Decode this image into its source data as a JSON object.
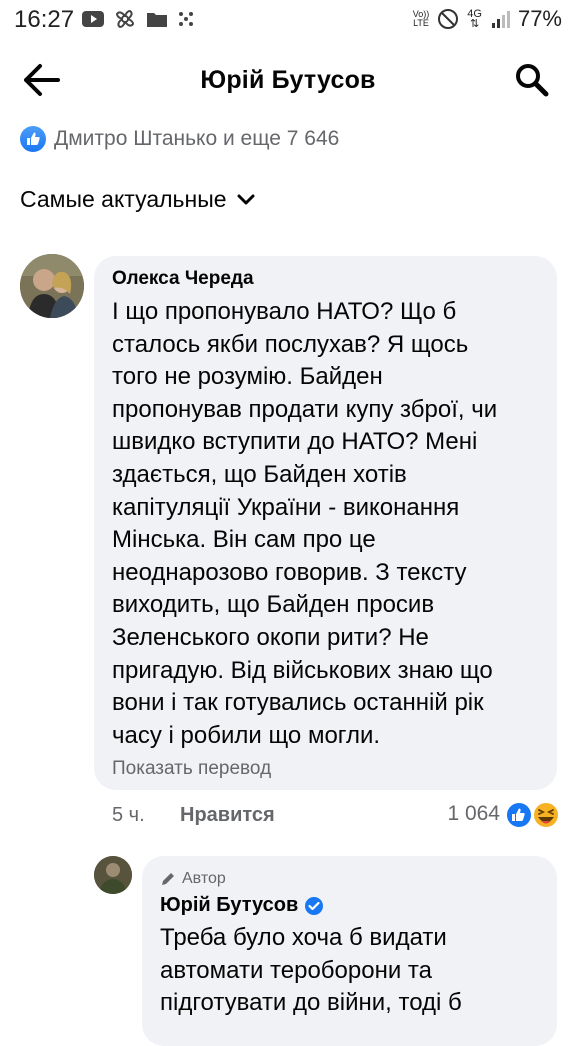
{
  "status_bar": {
    "time": "16:27",
    "left_icons": [
      "youtube-icon",
      "pinwheel-icon",
      "folder-icon",
      "dots-grid-icon"
    ],
    "volte": "Vo))\nLTE",
    "network": "4G",
    "battery": "77%"
  },
  "header": {
    "title": "Юрій Бутусов",
    "back_icon": "arrow-left-icon",
    "search_icon": "search-icon"
  },
  "reactions_summary": {
    "text": "Дмитро Штанько и еще 7 646",
    "icon": "like-icon"
  },
  "sort": {
    "label": "Самые актуальные",
    "icon": "chevron-down-icon"
  },
  "comments": [
    {
      "author": "Олекса Череда",
      "text": "І що пропонувало НАТО? Що б\nсталось якби послухав? Я щось\nтого не розумію. Байден\nпропонував продати купу зброї, чи\nшвидко вступити до НАТО? Мені\nздається, що Байден хотів\nкапітуляції України - виконання\nМінська. Він сам про це\nнеоднарозово говорив. З тексту\nвиходить, що Байден просив\nЗеленського окопи рити? Не\nпригадую. Від військових знаю що\nвони і так готувались останній рік\nчасу і робили що могли.",
      "translate": "Показать перевод",
      "time": "5 ч.",
      "like_label": "Нравится",
      "reaction_count": "1 064",
      "reaction_icons": [
        "like-icon",
        "haha-icon"
      ]
    }
  ],
  "reply": {
    "badge": "Автор",
    "badge_icon": "pencil-icon",
    "author": "Юрій Бутусов",
    "verified_icon": "verified-badge-icon",
    "text": "Треба було хоча б видати\nавтомати тероборони та\nпідготувати до війни, тоді б"
  },
  "colors": {
    "accent": "#1877f2",
    "bubble": "#f0f2f5",
    "secondary_text": "#65676b",
    "haha": "#f7b125"
  }
}
